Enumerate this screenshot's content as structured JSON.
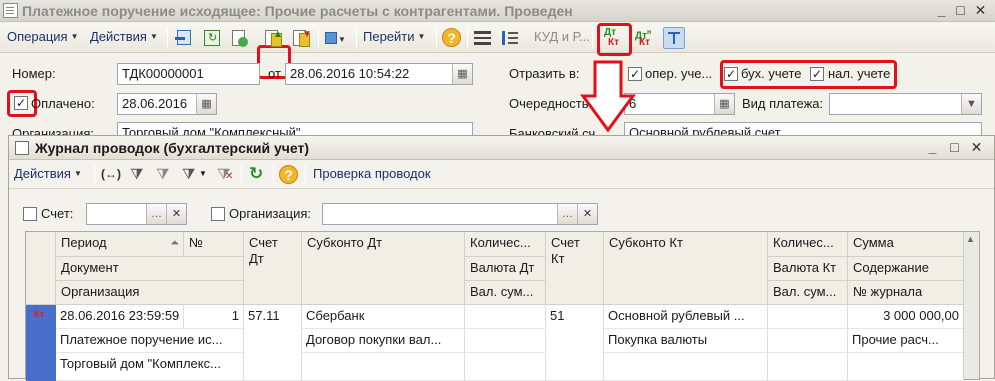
{
  "main_window": {
    "title": "Платежное поручение исходящее: Прочие расчеты с контрагентами. Проведен",
    "controls": {
      "minimize": "_",
      "maximize": "□",
      "close": "✕"
    }
  },
  "toolbar": {
    "operation": "Операция",
    "actions": "Действия",
    "goto": "Перейти",
    "kud": "КУД и Р...",
    "dt_kt": "Дт\nКт"
  },
  "form": {
    "number_label": "Номер:",
    "number_value": "ТДК00000001",
    "from_label": "от",
    "date_value": "28.06.2016 10:54:22",
    "paid_label": "Оплачено:",
    "paid_date": "28.06.2016",
    "org_label": "Организация:",
    "org_value": "Торговый дом \"Комплексный\"",
    "reflect_label": "Отразить в:",
    "reflect_oper": "опер. уче...",
    "reflect_buh": "бух. учете",
    "reflect_nal": "нал. учете",
    "order_label": "Очередность:",
    "order_value": "6",
    "payment_type_label": "Вид платежа:",
    "bank_account_label": "Банковский сч...",
    "bank_account_value": "Основной рублевый счет"
  },
  "journal": {
    "title": "Журнал проводок (бухгалтерский учет)",
    "actions": "Действия",
    "check_entries": "Проверка проводок",
    "filter_account_label": "Счет:",
    "filter_org_label": "Организация:",
    "columns": {
      "period": "Период",
      "number": "№",
      "document": "Документ",
      "organization": "Организация",
      "account_dt": "Счет\nДт",
      "subconto_dt": "Субконто Дт",
      "qty_dt": "Количес...",
      "currency_dt": "Валюта Дт",
      "val_sum_dt": "Вал. сум...",
      "account_kt": "Счет\nКт",
      "subconto_kt": "Субконто Кт",
      "qty_kt": "Количес...",
      "currency_kt": "Валюта Кт",
      "val_sum_kt": "Вал. сум...",
      "sum": "Сумма",
      "content": "Содержание",
      "journal_no": "№ журнала"
    },
    "row": {
      "period": "28.06.2016 23:59:59",
      "number": "1",
      "document": "Платежное поручение ис...",
      "organization": "Торговый дом \"Комплекс...",
      "account_dt": "57.11",
      "subconto_dt_1": "Сбербанк",
      "subconto_dt_2": "Договор покупки вал...",
      "account_kt": "51",
      "subconto_kt_1": "Основной рублевый ...",
      "subconto_kt_2": "Покупка валюты",
      "sum": "3 000 000,00",
      "content": "Прочие расч..."
    }
  },
  "colors": {
    "highlight": "#e2101a",
    "row_marker": "#4a6fc8"
  }
}
